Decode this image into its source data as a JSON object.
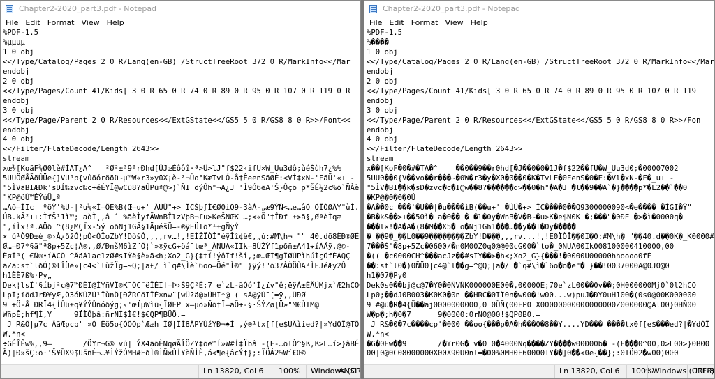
{
  "menu": [
    "File",
    "Edit",
    "Format",
    "View",
    "Help"
  ],
  "left": {
    "title": "Chapter2-2020_part3.pdf - Notepad",
    "lines": [
      "%PDF-1.5",
      "%µµµµ",
      "1 0 obj",
      "<</Type/Catalog/Pages 2 0 R/Lang(en-GB) /StructTreeRoot 372 0 R/MarkInfo<</Mar",
      "endobj",
      "2 0 obj",
      "<</Type/Pages/Count 41/Kids[ 3 0 R 65 0 R 74 0 R 89 0 R 95 0 R 107 0 R 119 0 R",
      "endobj",
      "3 0 obj",
      "<</Type/Page/Parent 2 0 R/Resources<</ExtGState<</GS5 5 0 R/GS8 8 0 R>>/Font<<",
      "endobj",
      "4 0 obj",
      "<</Filter/FlateDecode/Length 2643>>",
      "stream",
      "xœ¾[KoãF¾Ø0lè#ÌAT¿A^   ²Ø²±³9ªrÐhd[ÛJœÈôôî·ª>Û>lJ\"f$22‹ïfU×W_Uu3dô;ùéŠùh7¿%%",
      "5UUÖØÅÃöÛÜe{]VU³þ{vûõórööü~µ™W«r3»yüX¡è-²¬Üo°KæTvLÓ-å†ÊeenSãØÈ:<VÍ‡xN-'FãÜ'«+ -",
      "\"5ÌVäBIÆÐk'sDÍ‰zvc‰c+éÉYÏ@wCü8?äÛPüª@>)`ÑI öýÔh\"¬A¿J 'Ì9Ó6ëA'Š}Ôçõ p*ŠÉ½2c%ö`ÑÀè",
      "\"KP@öÙ™ÉÝúÜ„ª",
      "…Aõ—ÌIc  ºöÝ'%U-|²u¼«Í—ÖÈ%B(Œ—u+' ÃÙÜ\"+> ÏCŠþƒÍ€Ø0iQ9-3àÀ-„æ9ÝÑ<…e…âÕ ÕÎÓØÃÝ\"ùÍ.k",
      "ÚB.kÃ²++÷ÌfŠ¹1ì™; aòÌ¸,â ˆ %ãèÌyfÃWnBÎlzVþB¬£u>KeŠNŒK …;<«Ö\"†ÎÐf ±>ã§,ØªèÌqæ",
      "\",íÌx!ª.AÖð ^(8¿MÇÏx-5ý oðNj1GÃ§1ÄµéšÜ=-®ÿEÜTõ*¹±gÑÿÝ",
      "× ú¹Ò9Ð±è_®›Â¿ðžÓ¦pÒ<ÒÎoZbY!DòšÓ,,,,rv…!,!EÌŽÏÒÎ\"éÿÎî¢ê€,„ú:#M\\h¬ \"\" 40.dö8ÈÐ®ØÉKÊä",
      "Ø…—Ð7*§ä\"ª8p+5Zc¦Á®,,Ø/ÐnšM6ìZ¨Ö¦`»®ÿcG÷öá¯tœ³_ÃNUA«ÏIk—8ÚŽÝf1pðñ±A41÷íÃÅÿ,@©-",
      "ÊøÌ³( €Ñ®•íÃCÖ ^ÄäÃlac1zØ#sIÝë§è»ä<h;Xo2_G}{‡tí!ýôÏf!šî,;œ…ŒÍ¶gÎØÙPìhúÍçÔfÉÀQÇ",
      "äZä:st`lðÓ)®lÎÜë»|c4<`lùžÏg=~Q;|a£/_ì`q#\\Ìè`6oo—Õé\"Ì®\" }ÿý!\"õ37ÀÒÖÙA²ÌEJéÆy2Ô",
      "h1ÈÈ7ß%·Py„",
      "Dek¦lsÎ'§íbj²c@7™ÐÉÏ@ÌÝñVÎ®K¯ÖC¨ëÎÈÌ†—Þ›Š9Ç²Ê;7 e`zL-ãÓó'Ì¿ïv\"ê;ëÿÀ±ÉÂÛMjx`Æ2hCO€Î",
      "LpÏ;ïðdJrÐ¥yÆ,Ö3óKÙZÙ¹ÎùnÔ[ÐŽRCöIÎÈ®nw¨[wÜ?ä@¤ÜHI*@ ( sÃ@ÿÙ¯[=ÿ,,ÜÐØ",
      "9 +Ö-Å¯ÐRÏ4{ÍÛü±q¥ÝÝÛñóðýg;‹'œÏµWìü{ÏØFP¯x—µõ»Ñõ†Ï—ãÕ+-§·ŠÝZø[Ü»\"M€ÙTM@",
      "WñpÊ;hf¶Ì,Y     9ÏÌÔþâ:ñrNÍ$Ì€!$€QP¶BÜÕ.=",
      " J R&Ö|µ7c ÄãÆpcp' »Ò Ëö5o{ÒÖÕp`Ææh|ÏØ|ÏÍ8ÁPYÙžYÐ¬♠Í ,ý®¹tx[f[e$ÙÄìied?|»YdÒÎ@TÖáº¾",
      "W.*n<",
      "÷GÉÎÊw%,,9—       /ÖYr¬G®_vú| ÝX4äõÈNqøÄÎÖZY‡õë™Í»W#Í‡Ïbâ -(F-…õlÒ^§ß,ß>L…í>}âBÉä",
      "Ä)|Ð»šÇ:ö·'Š¥ÜX9$UšñÉ¬…¥ÌÝžÓMHÆFðÌ®ÌÑ×ÙÍYèÑÌÈ,á<¶e{â¢Ý†};:ÏÖÁ2%Wí€Œ©"
    ],
    "status": {
      "position": "Ln 13820, Col 6",
      "zoom": "100%",
      "line_ending": "Windows (CRLF)",
      "encoding": "ANSI"
    }
  },
  "right": {
    "title": "Chapter2-2020_part3.pdf - Notepad",
    "lines": [
      "%PDF-1.5",
      "%����",
      "1 0 obj",
      "<</Type/Catalog/Pages 2 0 R/Lang(en-GB) /StructTreeRoot 372 0 R/MarkInfo<</Mar",
      "endobj",
      "2 0 obj",
      "<</Type/Pages/Count 41/Kids[ 3 0 R 65 0 R 74 0 R 89 0 R 95 0 R 107 0 R 119",
      "endobj",
      "3 0 obj",
      "<</Type/Page/Parent 2 0 R/Resources<</ExtGState<</GS5 5 0 R/GS8 8 0 R>>/Fon",
      "endobj",
      "4 0 obj",
      "<</Filter/FlateDecode/Length 2643>>",
      "stream",
      "x��[KoF�0�#�TA�^    ��0��9��r0hd[�J��0�0�1J�f$22��fU�W_Uu3d0;�00007002",
      "5UU0��0{V��vo��r���~�0W�r3�y�X0�0��0�K�TvLE�0EenS�0�E:�Vl�xN-�F�_u+ -",
      "\"5ÌV�BI��k�sD�zvc�c�I@w��8?������q>��0�h\"�A�J �l��9��A`�}����p*�L2��`��0",
      "�KP@�0�0�0Ú",
      "�A��0c ���'�U��|�u����ìB(��u+' �ÙÜ�+> ÏC����0��Q9300000090<�e���� �ÍGI�Ý\"",
      "�B�k&��>+��50ì� a�0�� � �l�0y�WnB�V�B~�u>K�e$N0K �;���\"�0ÐE �>�ì�0000q�",
      "���l×!�A�A�(8�M��X5� o�Nj1Gh1���…��y��T�0y�����",
      "� ��9�_��L0��9��������ZbY!D���,,,rv...!,!E0ÏÒÎ��0I�0:#M\\h� \"��40.d��0K�_K0000#X",
      "7���Š\"�8p+5Zc�0600/�n0M00Z0q0@@00cG00�`to�_0NUA00Ik008100000410000,00",
      "�(( �c0000CH^���acJz��#sIY��>�h<;Xo2_G}{���!�0000Ú00000hhoooo0fÉ",
      "��:st`l0�)0ÑÜ0|c4@`l��g=^@Q;|a�/_�`q#\\ì�`6o�o�e\"� }��!0037000A@0J0@0",
      "h1�07�Py0",
      "Dek0s0��bj@c@7�Y0�0ÑVÑK000000E00�,00000E;70e`zL00��0v��;0H000000Mj0`0l2hCO",
      "Lp0;��dJ0B003�K0K0�0n ��HRC�0IÎ0n�w00�!w00...w)puJ�ÐÝ0uH100�(0s0@00K000000",
      "9 #@ü�R�4{Ü��aj0000000000,0'0ÜÑ(00FP0 X00000000000000000Z000000@Al00}0HÑ00",
      "W�p�;h�0�7      9�0000:0rN0@00!$QP0B0.=",
      " J R&�0�7c����cp'�000 ��oo{���p�A�h���0�8��Y....YD��� ����tx0f[e$���ed?|�YdÒÎ",
      "W.*n<",
      "�G�0Ew��9       /�Yr0G�_v�0 0�4000Nq����ZY����w00Ð00b� -(F���0^00,0>L00>}0B00",
      "00|0@0C08000000X00X90U0nl=�00%0MH0F60000IY��]0��<0e{��};:0IÖ02�w00)0Œ0"
    ],
    "status": {
      "position": "Ln 13820, Col 6",
      "zoom": "100%",
      "line_ending": "Windows (CRLF)",
      "encoding": "UTF-8"
    }
  }
}
